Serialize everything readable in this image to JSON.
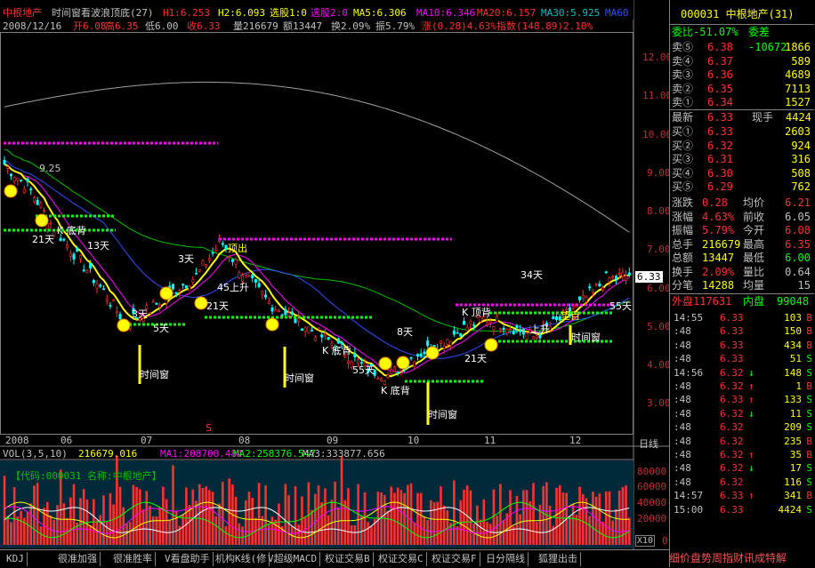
{
  "title": {
    "name": "中根地产",
    "indicator": "时间窗看波浪顶底(27)",
    "h1": "H1:6.253",
    "h2": "H2:6.093",
    "sel1": "选股1:0",
    "sel2": "选股2:0",
    "ma5": "MA5:6.306",
    "ma10": "MA10:6.346",
    "ma20": "MA20:6.157",
    "ma30": "MA30:5.925",
    "ma60": "MA60"
  },
  "info": {
    "date": "2008/12/16",
    "open": "开6.08",
    "high": "高6.35",
    "low": "低6.00",
    "close": "收6.33",
    "volume": "量216679",
    "amount": "额13447",
    "turnover": "换2.09%",
    "amplitude": "振5.79%",
    "change": "涨(0.28)4.63%",
    "index": "指数(148.89)2.10%"
  },
  "volume_header": {
    "vol": "VOL(3,5,10)",
    "v1": "216679.016",
    "ma1": "MA1:208700.484",
    "ma2": "MA2:258376.547",
    "ma3": "MA3:333877.656",
    "code_line": "【代码:000031 名称:中根地产】"
  },
  "x_axis_labels": [
    "2008",
    "06",
    "07",
    "08",
    "09",
    "10",
    "11",
    "12"
  ],
  "period_label": "日线",
  "y_axis_labels": [
    "12.00",
    "11.00",
    "10.00",
    "9.00",
    "8.00",
    "7.00",
    "6.00",
    "5.00",
    "4.00",
    "3.00"
  ],
  "vol_axis_labels": [
    "80000",
    "60000",
    "40000",
    "20000",
    "0"
  ],
  "vol_multiplier": "X10",
  "current_price_tag": "6.33",
  "annotations": {
    "label_925": "9.25",
    "window": "时间窗",
    "bottom_k": "K 底背",
    "top_k": "K 顶背",
    "days21": "21天",
    "days34": "34天",
    "days55": "55天",
    "days3": "3天",
    "days5": "5天",
    "days8": "8天",
    "days13": "13天",
    "rise": "上升",
    "up45": "45上升",
    "hope": "望目",
    "s_mark": "S",
    "top_out": "顶出"
  },
  "chart_data": {
    "type": "line",
    "title": "",
    "xlabel": "",
    "ylabel": "",
    "ylim": [
      2.5,
      12.6
    ],
    "series": [
      {
        "name": "",
        "values": [
          9.2,
          8.6,
          7.6,
          6.8,
          6.0,
          5.1,
          5.4,
          5.9,
          6.3,
          7.2,
          6.3,
          5.6,
          5.2,
          4.8,
          4.4,
          3.9,
          3.7,
          4.2,
          4.5,
          4.9,
          5.2,
          5.0,
          4.7,
          5.1,
          5.6,
          6.2,
          6.33
        ]
      }
    ]
  },
  "right_panel": {
    "stock": "000031 中根地产(31)",
    "weibi": "委比-51.07%",
    "weicha": "委差 -10672",
    "sells": [
      {
        "label": "卖⑤",
        "price": "6.38",
        "vol": "1866"
      },
      {
        "label": "卖④",
        "price": "6.37",
        "vol": "589"
      },
      {
        "label": "卖③",
        "price": "6.36",
        "vol": "4689"
      },
      {
        "label": "卖②",
        "price": "6.35",
        "vol": "7113"
      },
      {
        "label": "卖①",
        "price": "6.34",
        "vol": "1527"
      }
    ],
    "latest_label": "最新",
    "latest_price": "6.33",
    "xianshou_label": "现手",
    "xianshou": "4424",
    "buys": [
      {
        "label": "买①",
        "price": "6.33",
        "vol": "2603"
      },
      {
        "label": "买②",
        "price": "6.32",
        "vol": "924"
      },
      {
        "label": "买③",
        "price": "6.31",
        "vol": "316"
      },
      {
        "label": "买④",
        "price": "6.30",
        "vol": "508"
      },
      {
        "label": "买⑤",
        "price": "6.29",
        "vol": "762"
      }
    ],
    "stats": [
      {
        "l1": "涨跌",
        "v1": "0.28",
        "l2": "均价",
        "v2": "6.21"
      },
      {
        "l1": "涨幅",
        "v1": "4.63%",
        "l2": "前收",
        "v2": "6.05"
      },
      {
        "l1": "振幅",
        "v1": "5.79%",
        "l2": "今开",
        "v2": "6.08"
      },
      {
        "l1": "总手",
        "v1": "216679",
        "l2": "最高",
        "v2": "6.35"
      },
      {
        "l1": "总额",
        "v1": "13447",
        "l2": "最低",
        "v2": "6.00"
      },
      {
        "l1": "换手",
        "v1": "2.09%",
        "l2": "量比",
        "v2": "0.64"
      },
      {
        "l1": "分笔",
        "v1": "14288",
        "l2": "均量",
        "v2": "15"
      }
    ],
    "waipan": "外盘117631",
    "neipan": "内盘",
    "neipan_val": "99048",
    "ticks": [
      {
        "time": "14:55",
        "price": "6.33",
        "vol": "103",
        "bs": "B",
        "arrow": ""
      },
      {
        "time": ":48",
        "price": "6.33",
        "vol": "150",
        "bs": "B",
        "arrow": ""
      },
      {
        "time": ":48",
        "price": "6.33",
        "vol": "434",
        "bs": "B",
        "arrow": ""
      },
      {
        "time": ":48",
        "price": "6.33",
        "vol": "51",
        "bs": "S",
        "arrow": ""
      },
      {
        "time": "14:56",
        "price": "6.32",
        "vol": "148",
        "bs": "S",
        "arrow": "↓"
      },
      {
        "time": ":48",
        "price": "6.32",
        "vol": "1",
        "bs": "B",
        "arrow": "↑"
      },
      {
        "time": ":48",
        "price": "6.33",
        "vol": "133",
        "bs": "S",
        "arrow": "↑"
      },
      {
        "time": ":48",
        "price": "6.32",
        "vol": "11",
        "bs": "S",
        "arrow": "↓"
      },
      {
        "time": ":48",
        "price": "6.32",
        "vol": "209",
        "bs": "S",
        "arrow": ""
      },
      {
        "time": ":48",
        "price": "6.32",
        "vol": "235",
        "bs": "B",
        "arrow": ""
      },
      {
        "time": ":48",
        "price": "6.32",
        "vol": "35",
        "bs": "B",
        "arrow": "↑"
      },
      {
        "time": ":48",
        "price": "6.32",
        "vol": "17",
        "bs": "S",
        "arrow": "↓"
      },
      {
        "time": ":48",
        "price": "6.32",
        "vol": "116",
        "bs": "S",
        "arrow": ""
      },
      {
        "time": "14:57",
        "price": "6.33",
        "vol": "341",
        "bs": "B",
        "arrow": "↑"
      },
      {
        "time": "15:00",
        "price": "6.33",
        "vol": "4424",
        "bs": "S",
        "arrow": ""
      }
    ]
  },
  "tabs": [
    "KDJ",
    "很准加强",
    "很准胜率",
    "V看盘助手",
    "机构K线(修",
    "V超级MACD",
    "权证交易B",
    "权证交易C",
    "权证交易F",
    "日分隔线",
    "狐狸出击"
  ],
  "marquee": "细价盘势周指财讯成特解",
  "colors": {
    "red": "#ff3030",
    "green": "#00ff00",
    "yellow": "#ffff00",
    "magenta": "#ff00ff",
    "cyan": "#00c0c0",
    "white": "#ffffff"
  }
}
